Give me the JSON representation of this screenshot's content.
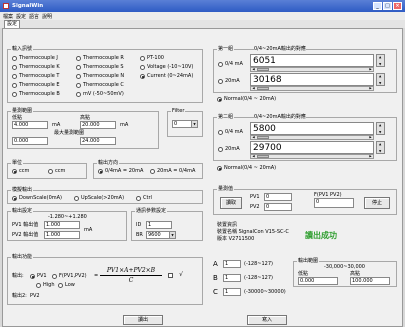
{
  "window": {
    "title": "SignalWin",
    "btn_min": "_",
    "btn_max": "□",
    "btn_close": "×"
  },
  "menu": [
    "檔案",
    "設定",
    "語言",
    "說明"
  ],
  "tab": "設定",
  "input_type": {
    "title": "輸入訊號",
    "options": [
      "Thermocouple J",
      "Thermocouple K",
      "Thermocouple T",
      "Thermocouple E",
      "Thermocouple B",
      "Thermocouple R",
      "Thermocouple S",
      "Thermocouple N",
      "Thermocouple C",
      "mV (-50~50mV)",
      "PT-100",
      "Voltage (-10~10V)",
      "Current (0~24mA)"
    ],
    "selected": "Current (0~24mA)"
  },
  "input_range": {
    "title": "量測範圍",
    "low_label": "低點",
    "high_label": "高點",
    "low_value": "4.000",
    "high_value": "20.000",
    "unit": "mA",
    "max_label": "最大量測範圍",
    "min_value": "0.000",
    "max_value": "24.000"
  },
  "filter": {
    "label": "Filter",
    "value": "0"
  },
  "units": {
    "title": "單位",
    "opt1": "ccm",
    "opt2": "ccm"
  },
  "output_dir": {
    "title": "輸出方向",
    "opt1": "0/4mA = 20mA",
    "opt2": "20mA = 0/4mA"
  },
  "module_out": {
    "title": "模擬輸出",
    "opt1": "DownScale(0mA)",
    "opt2": "UpScale(>20mA)",
    "opt3": "Ctrl"
  },
  "scaling": {
    "title": "輸出設定",
    "range": "-1.280~+1.280",
    "pv1_label": "PV1 輸出值",
    "pv2_label": "PV2 輸出值",
    "pv1_value": "1.000",
    "pv2_value": "1.000",
    "unit": "mA"
  },
  "comm": {
    "title": "通訊參數設定",
    "id_label": "ID",
    "br_label": "BR",
    "id_value": "1",
    "br_value": "9600"
  },
  "ch1": {
    "title": "第一組",
    "subtitle": "0/4~20mA輸出的對應",
    "opt_a": "0/4 mA",
    "val_a": "6051",
    "opt_b": "20mA",
    "val_b": "30168",
    "normal": "Normal(0/4 ~ 20mA)"
  },
  "ch2": {
    "title": "第二組",
    "subtitle": "0/4~20mA輸出的對應",
    "opt_a": "0/4 mA",
    "val_a": "5800",
    "opt_b": "20mA",
    "val_b": "29700",
    "normal": "Normal(0/4 ~ 20mA)"
  },
  "measure": {
    "title": "量測值",
    "read_btn": "讀取",
    "pv1_label": "PV1",
    "pv2_label": "PV2",
    "pvf_label": "F(PV1 PV2)",
    "pv1": "0",
    "pv2": "0",
    "pvf": "0",
    "stop_btn": "停止"
  },
  "device_info": {
    "title": "裝置資訊",
    "line1": "裝置名稱  SignalCon  V15-SC-C",
    "line2": "版本       V2711500"
  },
  "status_msg": "讀出成功",
  "output_calc": {
    "title": "輸出功能",
    "label": "輸出:",
    "opt_pv1": "PV1",
    "opt_f": "F(PV1,PV2)",
    "opt_high": "High",
    "opt_low": "Low",
    "output2_label": "輸出2:",
    "output2_value": "PV2",
    "formula_num": "PV1×A+PV2×B",
    "formula_den": "C",
    "sqrt": "√"
  },
  "coefficients": {
    "a_label": "A",
    "b_label": "B",
    "c_label": "C",
    "a_value": "1",
    "b_value": "1",
    "c_value": "1",
    "a_range": "(-128~127)",
    "b_range": "(-128~127)",
    "c_range": "(-30000~30000)"
  },
  "output_range": {
    "title": "輸出範圍",
    "range": "-30,000~30,000",
    "low_label": "低點",
    "high_label": "高點",
    "low_value": "0.000",
    "high_value": "100.000"
  },
  "buttons": {
    "read": "讀出",
    "write": "寫入"
  }
}
